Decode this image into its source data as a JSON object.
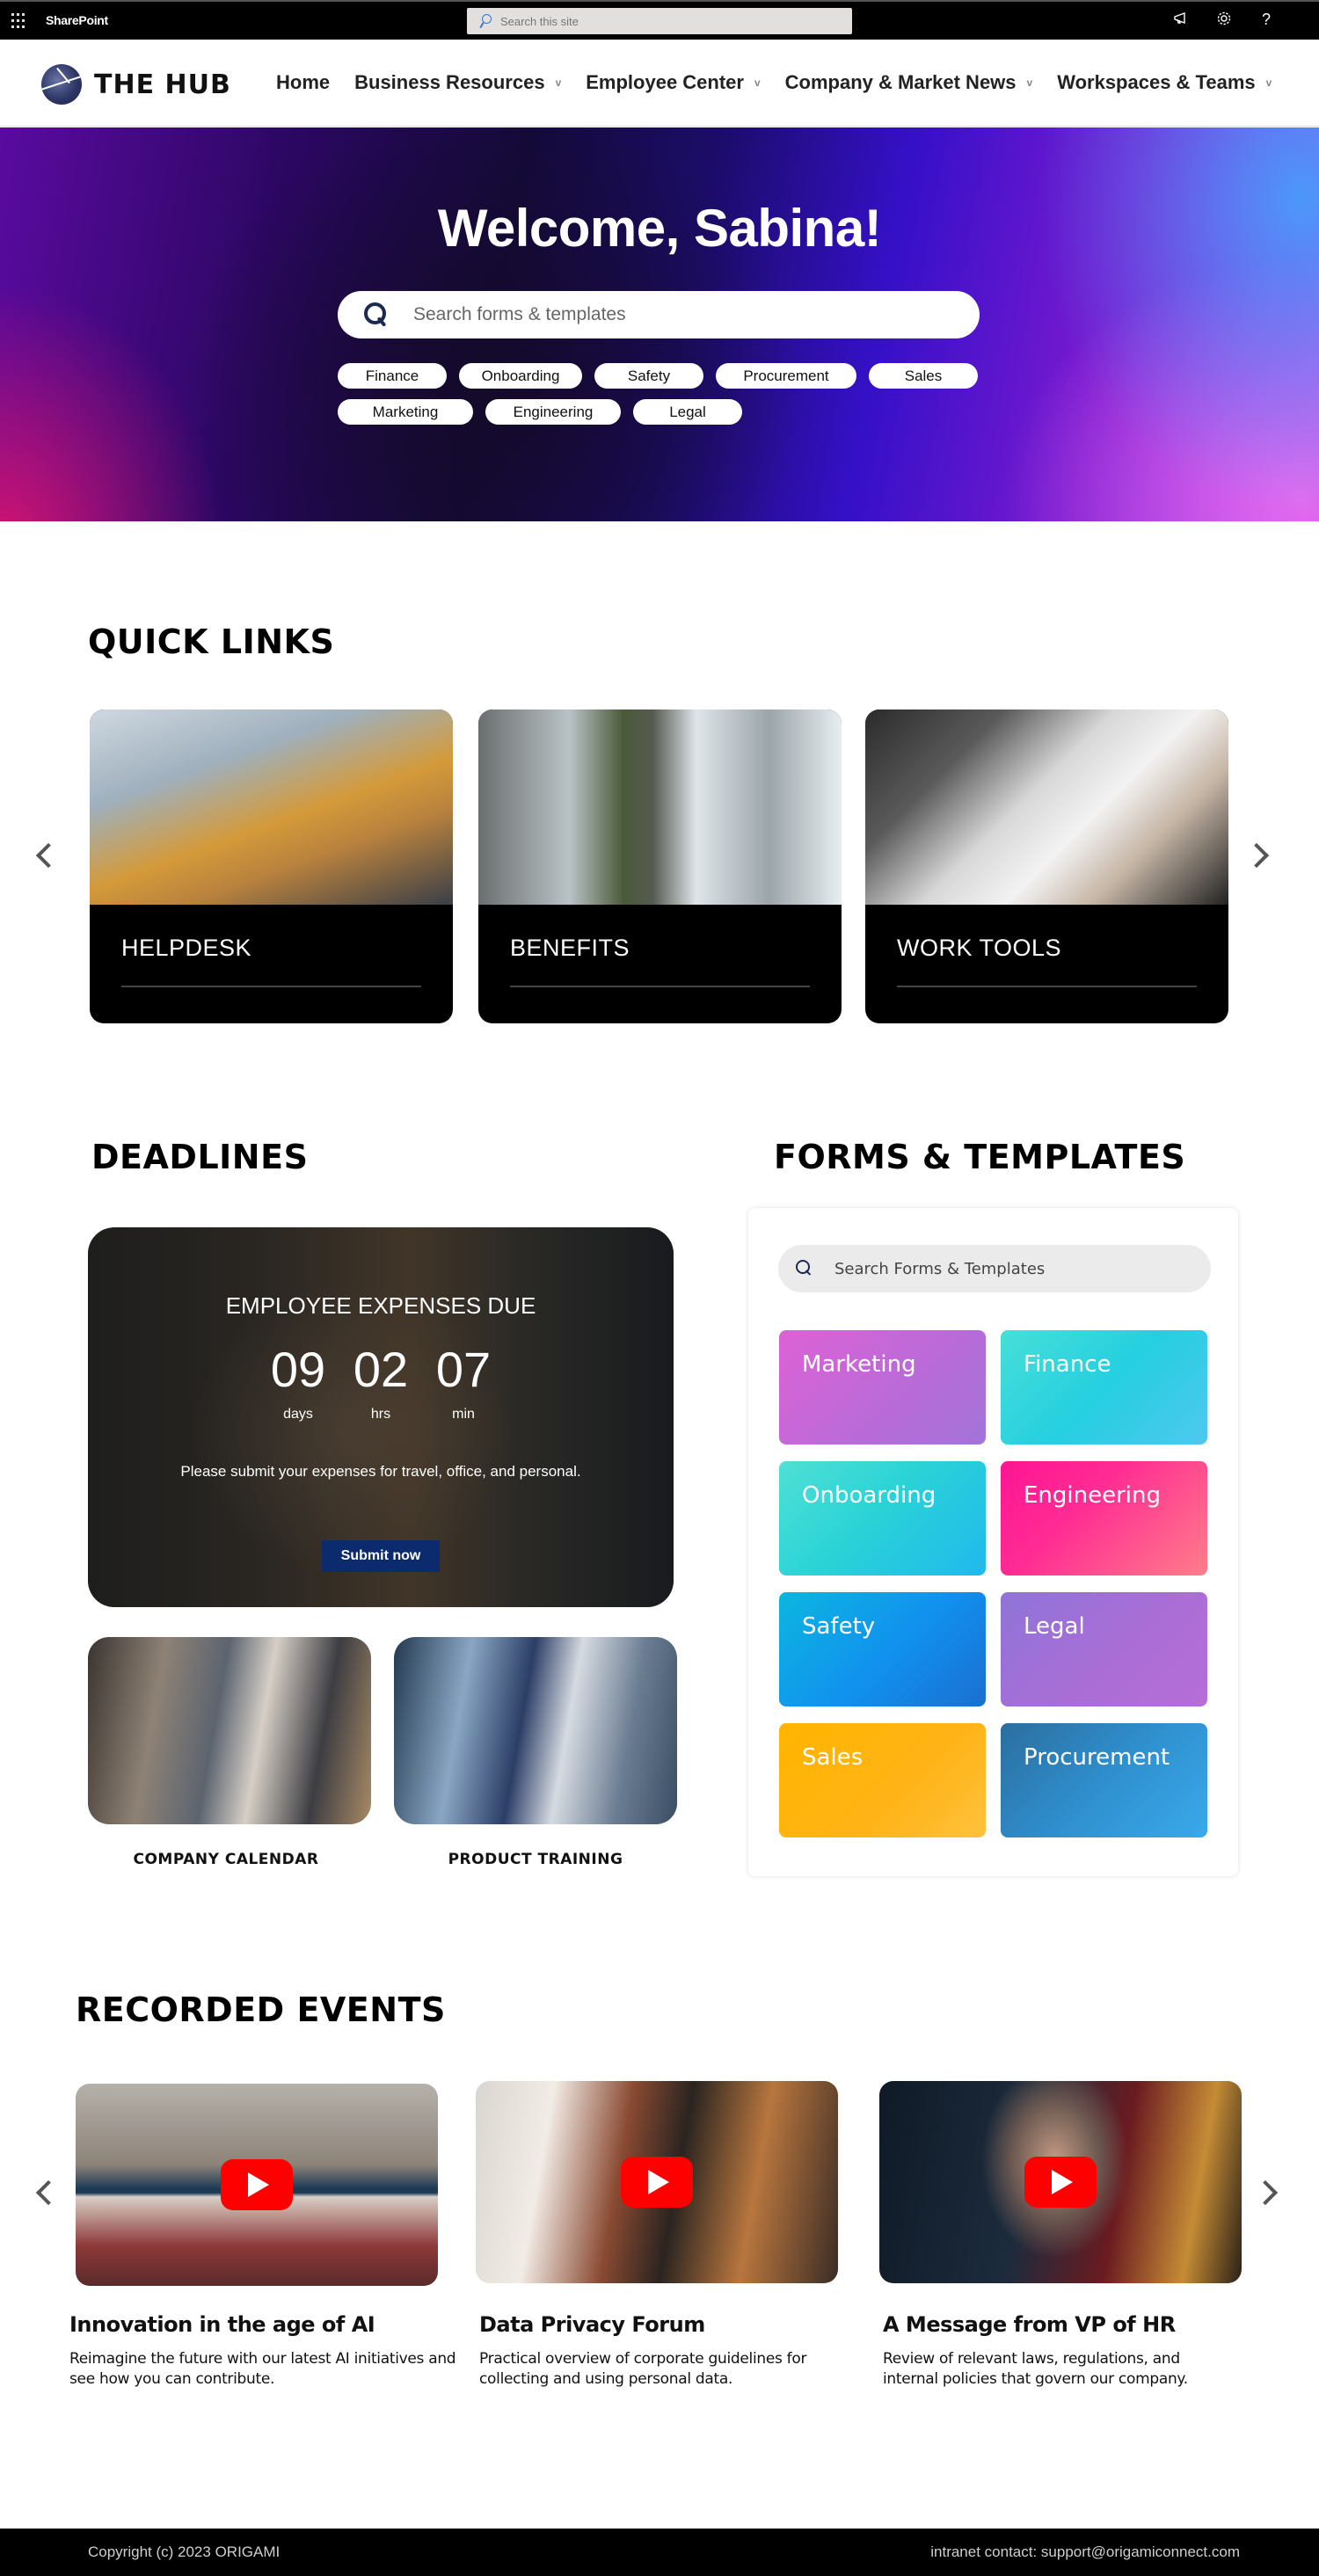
{
  "suite_bar": {
    "app_name": "SharePoint",
    "search_placeholder": "Search this site",
    "icons": [
      "app-launcher-icon",
      "megaphone-icon",
      "gear-icon",
      "help-icon"
    ],
    "help_glyph": "?"
  },
  "site_header": {
    "logo_text": "THE HUB",
    "nav": [
      {
        "label": "Home",
        "has_dropdown": false
      },
      {
        "label": "Business Resources",
        "has_dropdown": true
      },
      {
        "label": "Employee Center",
        "has_dropdown": true
      },
      {
        "label": "Company & Market News",
        "has_dropdown": true
      },
      {
        "label": "Workspaces & Teams",
        "has_dropdown": true
      }
    ],
    "chevron_glyph": "v"
  },
  "hero": {
    "title": "Welcome, Sabina!",
    "search_placeholder": "Search forms & templates",
    "tags": [
      "Finance",
      "Onboarding",
      "Safety",
      "Procurement",
      "Sales",
      "Marketing",
      "Engineering",
      "Legal"
    ]
  },
  "quick_links": {
    "heading": "QUICK LINKS",
    "items": [
      {
        "label": "HELPDESK"
      },
      {
        "label": "BENEFITS"
      },
      {
        "label": "WORK TOOLS"
      }
    ]
  },
  "deadlines": {
    "heading": "DEADLINES",
    "featured": {
      "title": "EMPLOYEE EXPENSES DUE",
      "countdown": [
        {
          "value": "09",
          "unit": "days"
        },
        {
          "value": "02",
          "unit": "hrs"
        },
        {
          "value": "07",
          "unit": "min"
        }
      ],
      "message": "Please submit your expenses for travel, office, and personal.",
      "button_label": "Submit now"
    },
    "links": [
      {
        "label": "COMPANY CALENDAR"
      },
      {
        "label": "PRODUCT TRAINING"
      }
    ]
  },
  "forms_templates": {
    "heading": "FORMS & TEMPLATES",
    "search_placeholder": "Search Forms & Templates",
    "tiles": [
      "Marketing",
      "Finance",
      "Onboarding",
      "Engineering",
      "Safety",
      "Legal",
      "Sales",
      "Procurement"
    ]
  },
  "recorded_events": {
    "heading": "RECORDED EVENTS",
    "items": [
      {
        "title": "Innovation in the age of AI",
        "description": "Reimagine the future with our latest AI initiatives and see how you can contribute."
      },
      {
        "title": "Data Privacy Forum",
        "description": "Practical overview of corporate guidelines for collecting and using personal data."
      },
      {
        "title": "A Message from VP of HR",
        "description": "Review of relevant laws, regulations, and internal policies that govern our company."
      }
    ]
  },
  "footer": {
    "copyright": "Copyright (c) 2023 ORIGAMI",
    "contact": "intranet contact: support@origamiconnect.com"
  },
  "colors": {
    "suite_bar_bg": "#000000",
    "submit_button_bg": "#0c2a6e",
    "play_button": "#ff0000",
    "footer_bg": "#000000"
  }
}
